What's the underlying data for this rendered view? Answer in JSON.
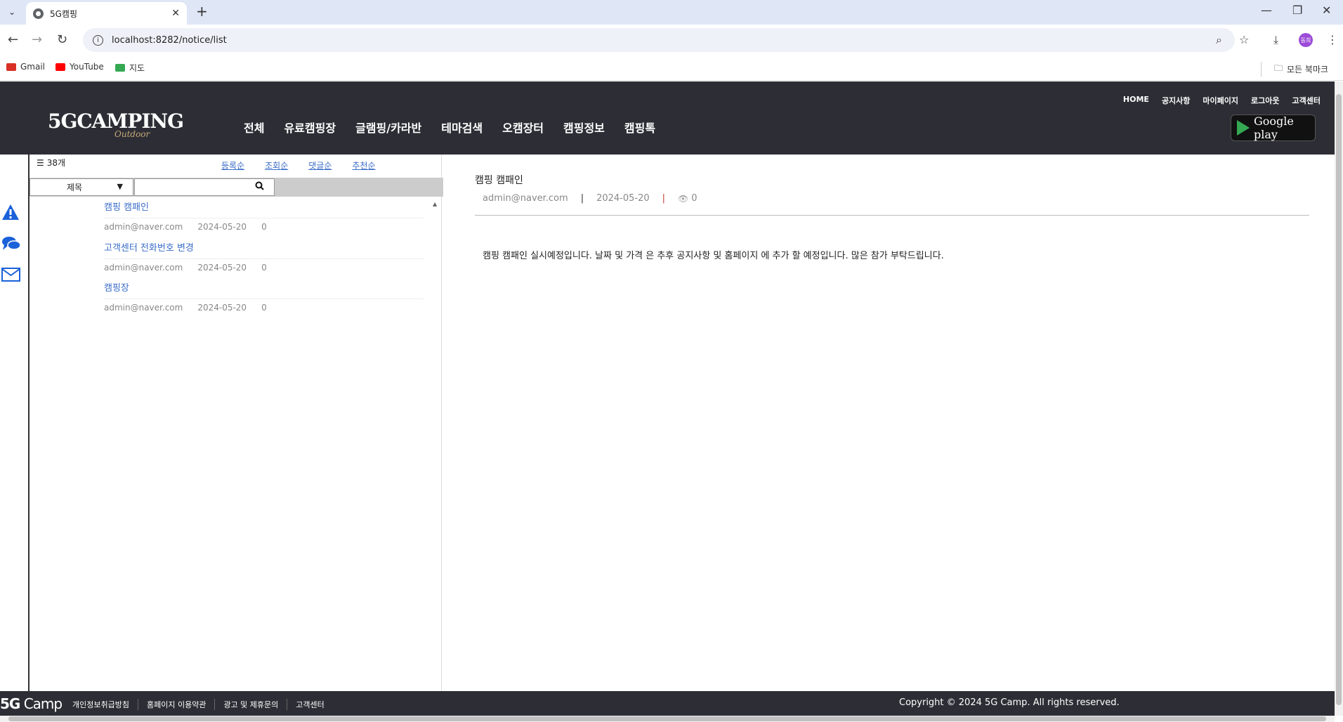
{
  "browser": {
    "tab_title": "5G캠핑",
    "url": "localhost:8282/notice/list",
    "bookmarks": [
      {
        "label": "Gmail",
        "icon": "gmail-icon",
        "color": "#d93025"
      },
      {
        "label": "YouTube",
        "icon": "youtube-icon",
        "color": "#ff0000"
      },
      {
        "label": "지도",
        "icon": "maps-icon",
        "color": "#34a853"
      }
    ],
    "all_bookmarks_label": "모든 북마크",
    "avatar_text": "동희"
  },
  "header": {
    "logo_main": "5GCAMPING",
    "logo_sub": "Outdoor",
    "nav": [
      "전체",
      "유료캠핑장",
      "글램핑/카라반",
      "테마검색",
      "오캠장터",
      "캠핑정보",
      "캠핑톡"
    ],
    "top_nav": [
      "HOME",
      "공지사항",
      "마이페이지",
      "로그아웃",
      "고객센터"
    ],
    "google_play_label": "Google play"
  },
  "list": {
    "count_label": "38개",
    "sort_links": [
      "등록순",
      "조회순",
      "댓글순",
      "추천순"
    ],
    "search_select_value": "제목",
    "search_placeholder": "",
    "items": [
      {
        "title": "캠핑 캠패인",
        "author": "admin@naver.com",
        "date": "2024-05-20",
        "views": "0"
      },
      {
        "title": "고객센터 전화번호 변경",
        "author": "admin@naver.com",
        "date": "2024-05-20",
        "views": "0"
      },
      {
        "title": "캠핑장",
        "author": "admin@naver.com",
        "date": "2024-05-20",
        "views": "0"
      }
    ]
  },
  "detail": {
    "title": "캠핑 캠패인",
    "author": "admin@naver.com",
    "date": "2024-05-20",
    "views": "0",
    "content": "캠핑 캠패인 실시예정입니다. 날짜 및 가격 은 추후 공지사항 및 홈페이지 에 추가 할 예정입니다. 많은 참가 부탁드립니다."
  },
  "footer": {
    "logo_5g": "5G",
    "logo_camp": " Camp",
    "links": [
      "개인정보취급방침",
      "홈페이지 이용약관",
      "광고 및 제휴문의",
      "고객센터"
    ],
    "copyright": "Copyright © 2024 5G Camp. All rights reserved."
  },
  "colors": {
    "header_bg": "#2d2e35",
    "link_blue": "#3a6cc8",
    "icon_blue": "#1a62d9",
    "tabbar_bg": "#dfe6f6"
  }
}
